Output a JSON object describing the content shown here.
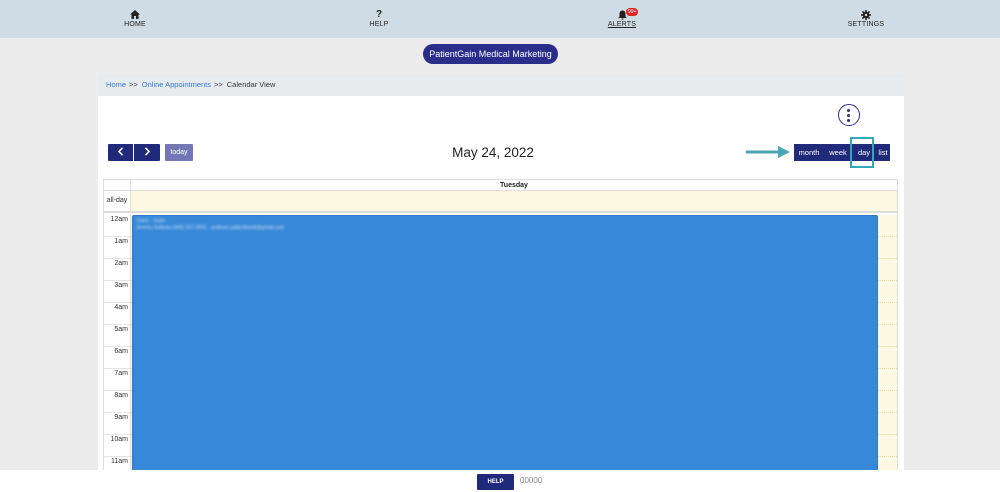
{
  "nav": {
    "home_label": "HOME",
    "help_label": "HELP",
    "alerts_label": "ALERTS",
    "alerts_badge": "99+",
    "settings_label": "SETTINGS",
    "icons": {
      "home": "home-icon",
      "help": "question-icon",
      "alerts": "bell-icon",
      "settings": "gear-icon"
    }
  },
  "account": {
    "name": "PatientGain Medical Marketing"
  },
  "breadcrumb": {
    "home": "Home",
    "sep1": ">>",
    "appointments": "Online Appointments",
    "sep2": ">>",
    "current": "Calendar View"
  },
  "toolbar": {
    "prev_icon": "chevron-left-icon",
    "next_icon": "chevron-right-icon",
    "today_label": "today",
    "title": "May 24, 2022",
    "views": {
      "month": "month",
      "week": "week",
      "day": "day",
      "list": "list"
    },
    "active_view": "day"
  },
  "calendar": {
    "day_header": "Tuesday",
    "allday_label": "all-day",
    "time_slots": [
      "12am",
      "1am",
      "2am",
      "3am",
      "4am",
      "5am",
      "6am",
      "7am",
      "8am",
      "9am",
      "10am",
      "11am"
    ],
    "event": {
      "line1": "12am - 11pm",
      "line2": "Jeremy Sullivan (605) 557-3591 · jsullivan.patientbook@gmail.com",
      "color": "#3788d8"
    }
  },
  "footer": {
    "help_label": "HELP",
    "count": "00000"
  },
  "colors": {
    "brand_dark": "#1f2a7a",
    "pill": "#2a2e8a",
    "highlight": "#32a8b8",
    "today_btn": "#7378b5",
    "slot_bg": "#fdf8e1"
  }
}
